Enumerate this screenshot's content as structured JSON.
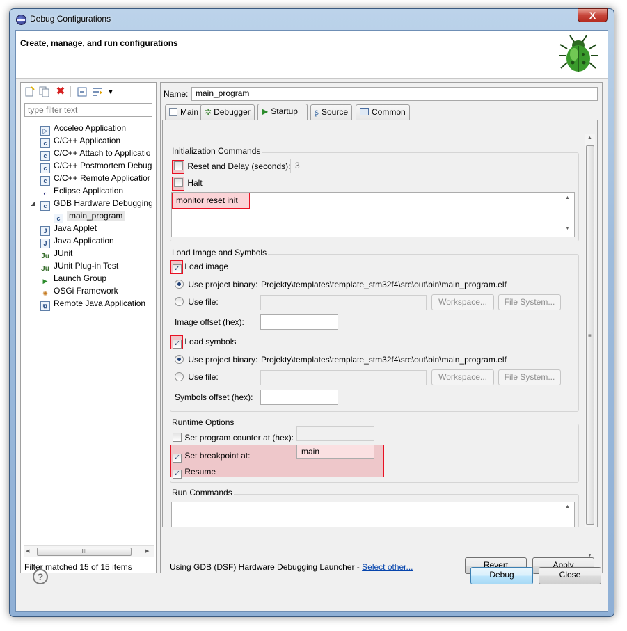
{
  "window": {
    "title": "Debug Configurations",
    "close_glyph": "X"
  },
  "banner": {
    "title": "Create, manage, and run configurations"
  },
  "left": {
    "filter_placeholder": "type filter text",
    "items": [
      {
        "label": "Acceleo Application",
        "icon": "acceleo-icon"
      },
      {
        "label": "C/C++ Application",
        "icon": "c-app-icon"
      },
      {
        "label": "C/C++ Attach to Applicatio",
        "icon": "c-app-icon"
      },
      {
        "label": "C/C++ Postmortem Debug",
        "icon": "c-app-icon"
      },
      {
        "label": "C/C++ Remote Applicatior",
        "icon": "c-app-icon"
      },
      {
        "label": "Eclipse Application",
        "icon": "eclipse-icon"
      },
      {
        "label": "GDB Hardware Debugging",
        "icon": "c-app-icon"
      },
      {
        "label": "main_program",
        "icon": "c-app-icon"
      },
      {
        "label": "Java Applet",
        "icon": "applet-icon"
      },
      {
        "label": "Java Application",
        "icon": "java-app-icon"
      },
      {
        "label": "JUnit",
        "icon": "junit-icon"
      },
      {
        "label": "JUnit Plug-in Test",
        "icon": "junit-plugin-icon"
      },
      {
        "label": "Launch Group",
        "icon": "launch-group-icon"
      },
      {
        "label": "OSGi Framework",
        "icon": "osgi-icon"
      },
      {
        "label": "Remote Java Application",
        "icon": "remote-java-icon"
      }
    ],
    "scroll_thumb_glyph": "III",
    "status": "Filter matched 15 of 15 items"
  },
  "right": {
    "name_label": "Name:",
    "name_value": "main_program",
    "tabs": [
      {
        "label": "Main"
      },
      {
        "label": "Debugger"
      },
      {
        "label": "Startup",
        "active": true
      },
      {
        "label": "Source"
      },
      {
        "label": "Common"
      }
    ],
    "init": {
      "title": "Initialization Commands",
      "reset_label": "Reset and Delay (seconds):",
      "reset_checked": false,
      "delay_value": "3",
      "halt_label": "Halt",
      "halt_checked": false,
      "commands": "monitor reset init"
    },
    "load": {
      "title": "Load Image and Symbols",
      "load_image_label": "Load image",
      "load_image_checked": true,
      "use_project_binary": "Use project binary:",
      "image_path": "Projekty\\templates\\template_stm32f4\\src\\out\\bin\\main_program.elf",
      "use_file": "Use file:",
      "workspace_btn": "Workspace...",
      "filesystem_btn": "File System...",
      "image_offset_label": "Image offset (hex):",
      "load_symbols_label": "Load symbols",
      "load_symbols_checked": true,
      "symbols_path": "Projekty\\templates\\template_stm32f4\\src\\out\\bin\\main_program.elf",
      "symbols_offset_label": "Symbols offset (hex):"
    },
    "runtime": {
      "title": "Runtime Options",
      "set_pc_label": "Set program counter at (hex):",
      "set_pc_checked": false,
      "breakpoint_label": "Set breakpoint at:",
      "breakpoint_checked": true,
      "breakpoint_value": "main",
      "resume_label": "Resume",
      "resume_checked": true
    },
    "run_commands": {
      "title": "Run Commands"
    },
    "launcher_text": "Using GDB (DSF) Hardware Debugging Launcher -",
    "launcher_link": "Select other...",
    "revert_btn": "Revert",
    "apply_btn": "Apply"
  },
  "footer": {
    "help_glyph": "?",
    "debug_btn": "Debug",
    "close_btn": "Close"
  },
  "colors": {
    "highlight": "#e81123",
    "link": "#0645ad",
    "title_bar": "#9fbcdc"
  }
}
